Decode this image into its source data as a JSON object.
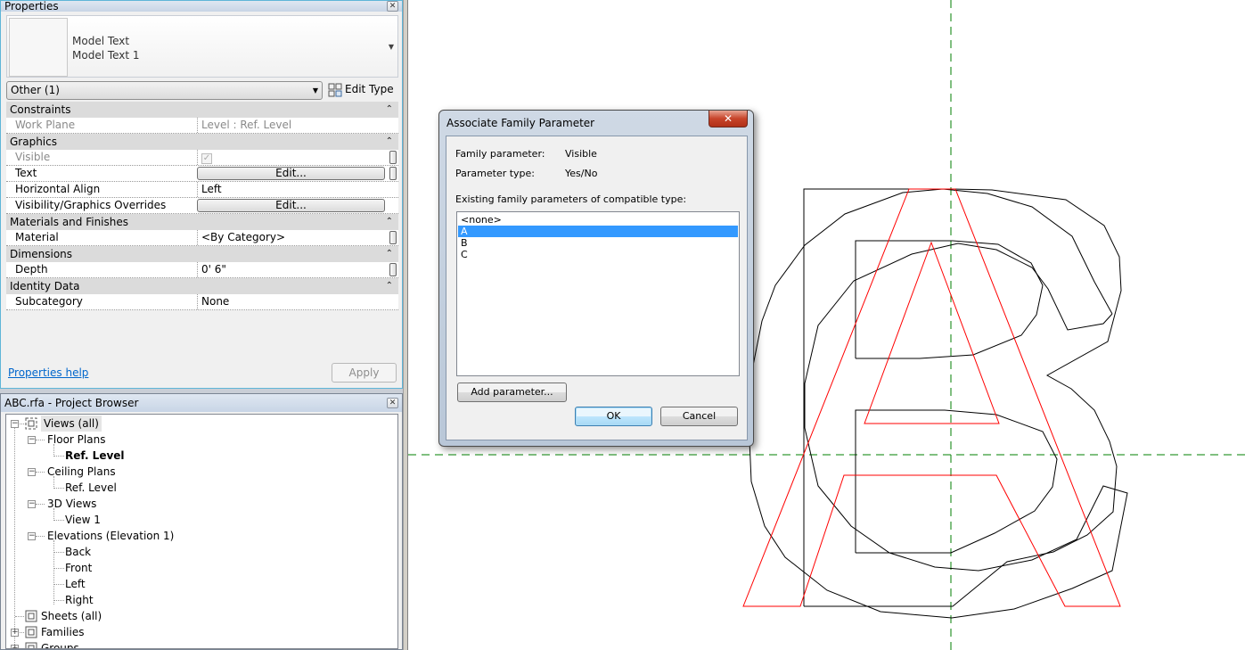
{
  "properties_panel": {
    "title": "Properties",
    "close_icon": "close-icon",
    "type_selector": {
      "line1": "Model Text",
      "line2": "Model Text 1"
    },
    "instance_filter": "Other (1)",
    "edit_type_label": "Edit Type",
    "groups": [
      {
        "name": "Constraints",
        "rows": [
          {
            "key": "Work Plane",
            "value": "Level : Ref. Level",
            "disabled": true
          }
        ]
      },
      {
        "name": "Graphics",
        "rows": [
          {
            "key": "Visible",
            "value": "checked",
            "disabled": true,
            "type": "checkbox"
          },
          {
            "key": "Text",
            "value": "Edit...",
            "type": "button"
          },
          {
            "key": "Horizontal Align",
            "value": "Left"
          },
          {
            "key": "Visibility/Graphics Overrides",
            "value": "Edit...",
            "type": "button"
          }
        ]
      },
      {
        "name": "Materials and Finishes",
        "rows": [
          {
            "key": "Material",
            "value": "<By Category>"
          }
        ]
      },
      {
        "name": "Dimensions",
        "rows": [
          {
            "key": "Depth",
            "value": "0'  6\""
          }
        ]
      },
      {
        "name": "Identity Data",
        "rows": [
          {
            "key": "Subcategory",
            "value": "None"
          }
        ]
      }
    ],
    "help_link": "Properties help",
    "apply_label": "Apply"
  },
  "project_browser": {
    "title": "ABC.rfa - Project Browser",
    "tree": [
      {
        "label": "Views (all)",
        "level": 0,
        "expander": "minus",
        "icon": "views-icon",
        "selected": true
      },
      {
        "label": "Floor Plans",
        "level": 1,
        "expander": "minus"
      },
      {
        "label": "Ref. Level",
        "level": 2,
        "bold": true
      },
      {
        "label": "Ceiling Plans",
        "level": 1,
        "expander": "minus"
      },
      {
        "label": "Ref. Level",
        "level": 2
      },
      {
        "label": "3D Views",
        "level": 1,
        "expander": "minus"
      },
      {
        "label": "View 1",
        "level": 2
      },
      {
        "label": "Elevations (Elevation 1)",
        "level": 1,
        "expander": "minus"
      },
      {
        "label": "Back",
        "level": 2
      },
      {
        "label": "Front",
        "level": 2
      },
      {
        "label": "Left",
        "level": 2
      },
      {
        "label": "Right",
        "level": 2
      },
      {
        "label": "Sheets (all)",
        "level": 0,
        "icon": "sheets-icon"
      },
      {
        "label": "Families",
        "level": 0,
        "expander": "plus",
        "icon": "families-icon"
      },
      {
        "label": "Groups",
        "level": 0,
        "expander": "plus",
        "icon": "groups-icon"
      }
    ]
  },
  "dialog": {
    "title": "Associate Family Parameter",
    "family_parameter_label": "Family parameter:",
    "family_parameter_value": "Visible",
    "parameter_type_label": "Parameter type:",
    "parameter_type_value": "Yes/No",
    "list_label": "Existing family parameters of compatible type:",
    "options": [
      "<none>",
      "A",
      "B",
      "C"
    ],
    "selected_option": "A",
    "add_parameter_label": "Add parameter...",
    "ok_label": "OK",
    "cancel_label": "Cancel"
  },
  "canvas": {
    "reference_plane_color": "#007f00",
    "model_text_color": "#000000",
    "selected_text_color": "#ff0000",
    "letters_shown": [
      "A",
      "B",
      "C"
    ]
  }
}
